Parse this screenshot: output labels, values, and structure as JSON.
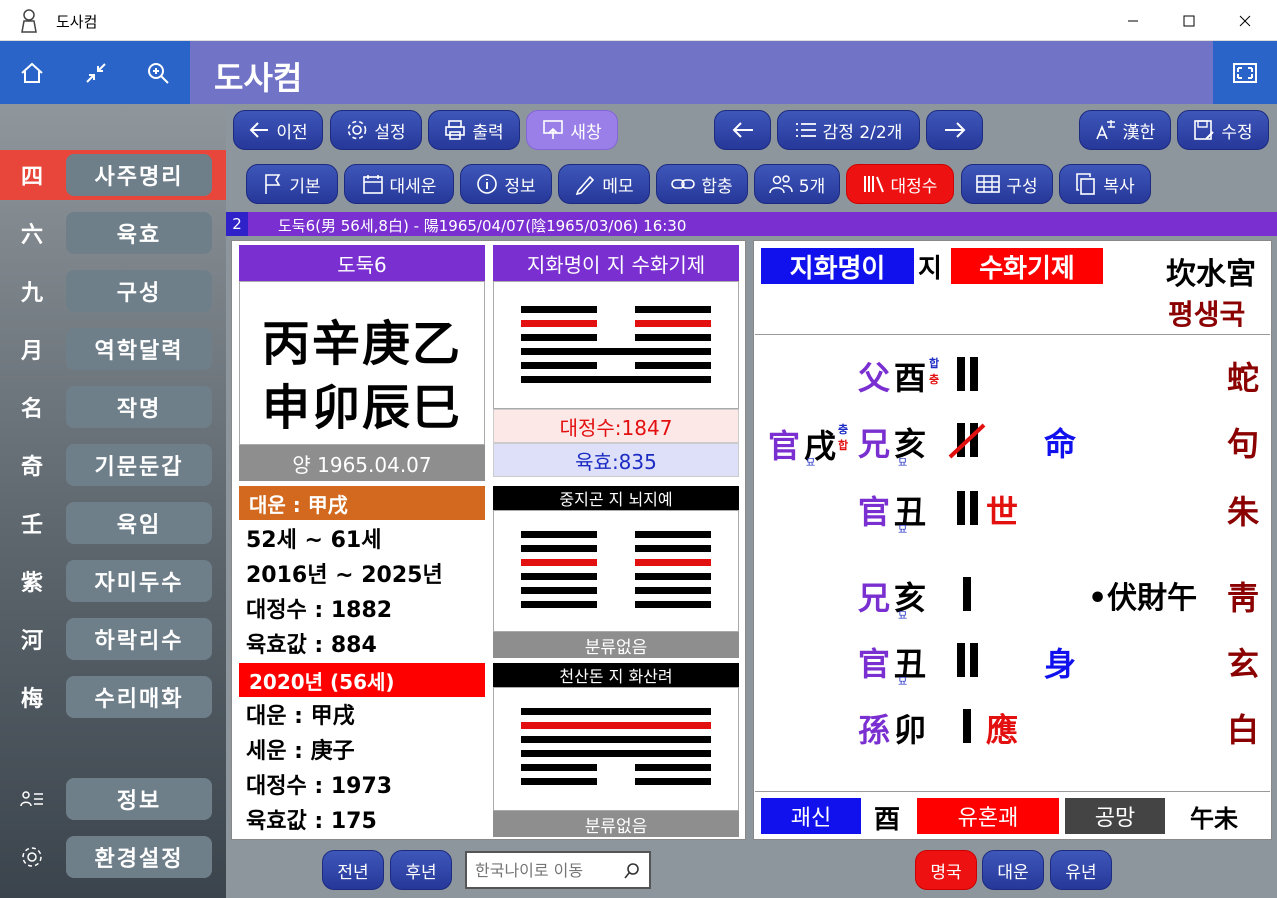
{
  "window": {
    "title": "도사컴"
  },
  "topbar": {
    "title": "도사컴"
  },
  "sidebar": {
    "items": [
      {
        "hanja": "四",
        "label": "사주명리"
      },
      {
        "hanja": "六",
        "label": "육효"
      },
      {
        "hanja": "九",
        "label": "구성"
      },
      {
        "hanja": "月",
        "label": "역학달력"
      },
      {
        "hanja": "名",
        "label": "작명"
      },
      {
        "hanja": "奇",
        "label": "기문둔갑"
      },
      {
        "hanja": "壬",
        "label": "육임"
      },
      {
        "hanja": "紫",
        "label": "자미두수"
      },
      {
        "hanja": "河",
        "label": "하락리수"
      },
      {
        "hanja": "梅",
        "label": "수리매화"
      }
    ],
    "bottom": [
      {
        "label": "정보"
      },
      {
        "label": "환경설정"
      }
    ]
  },
  "toolbar1": {
    "prev": "이전",
    "settings": "설정",
    "print": "출력",
    "newwin": "새창",
    "counter": "감정 2/2개",
    "hanja": "漢한",
    "edit": "수정"
  },
  "toolbar2": {
    "basic": "기본",
    "daeseun": "대세운",
    "info": "정보",
    "memo": "메모",
    "hapchung": "합충",
    "five": "5개",
    "daejeongsu": "대정수",
    "gusung": "구성",
    "copy": "복사"
  },
  "infobar": {
    "num": "2",
    "text": "도둑6(男 56세,8白) - 陽1965/04/07(陰1965/03/06) 16:30"
  },
  "left_panel": {
    "name": "도둑6",
    "saju_top": "丙辛庚乙",
    "saju_bottom": "申卯辰巳",
    "birth": "양 1965.04.07",
    "daeun_header": "대운 : 甲戌",
    "daeun_lines": [
      "52세 ~ 61세",
      "2016년 ~ 2025년",
      "대정수 : 1882",
      "육효값 : 884"
    ],
    "year_header": "2020년 (56세)",
    "year_lines": [
      "대운 : 甲戌",
      "세운 : 庚子",
      "대정수 : 1973",
      "육효값 : 175"
    ]
  },
  "mid_panel": {
    "gua1_title": "지화명이 지 수화기제",
    "daejeongsu": "대정수:1847",
    "yukhyo": "육효:835",
    "gua2_title": "중지곤 지 뇌지예",
    "gua2_foot": "분류없음",
    "gua3_title": "천산돈 지 화산려",
    "gua3_foot": "분류없음"
  },
  "right_panel": {
    "gua_main": "지화명이",
    "ji": "지",
    "gua_change": "수화기제",
    "palace": "坎水宮",
    "type": "평생국",
    "rows": [
      {
        "rel": "父",
        "branch": "酉",
        "mark_top": "합",
        "mark_bottom": "충",
        "line": "yin",
        "special": "",
        "six": "蛇",
        "rel_color": "#7a2fd0"
      },
      {
        "rel": "兄",
        "branch": "亥",
        "sub": "묘",
        "line": "yin-changing",
        "special": "命",
        "six": "句",
        "rel_color": "#7a2fd0"
      },
      {
        "rel": "官",
        "branch": "丑",
        "sub": "묘",
        "line": "yin",
        "special": "世",
        "six": "朱",
        "rel_color": "#7a2fd0"
      },
      {
        "rel": "兄",
        "branch": "亥",
        "sub": "묘",
        "line": "yang",
        "special": "",
        "six": "靑",
        "rel_color": "#7a2fd0"
      },
      {
        "rel": "官",
        "branch": "丑",
        "sub": "묘",
        "line": "yin",
        "special": "身",
        "six": "玄",
        "rel_color": "#7a2fd0"
      },
      {
        "rel": "孫",
        "branch": "卯",
        "line": "yang",
        "special": "應",
        "six": "白",
        "rel_color": "#7a2fd0"
      }
    ],
    "side_rel": "官",
    "side_branch": "戌",
    "side_sub": "묘",
    "side_top": "충",
    "side_bottom": "합",
    "hidden": "•伏財午",
    "footer": {
      "gwaesin": "괘신",
      "gwaesin_val": "酉",
      "yuhon": "유혼괘",
      "gongmang": "공망",
      "gongmang_val": "午未"
    }
  },
  "bottombar": {
    "prevyear": "전년",
    "nextyear": "후년",
    "search_placeholder": "한국나이로 이동",
    "myeong": "명국",
    "daeun": "대운",
    "yunyear": "유년"
  }
}
